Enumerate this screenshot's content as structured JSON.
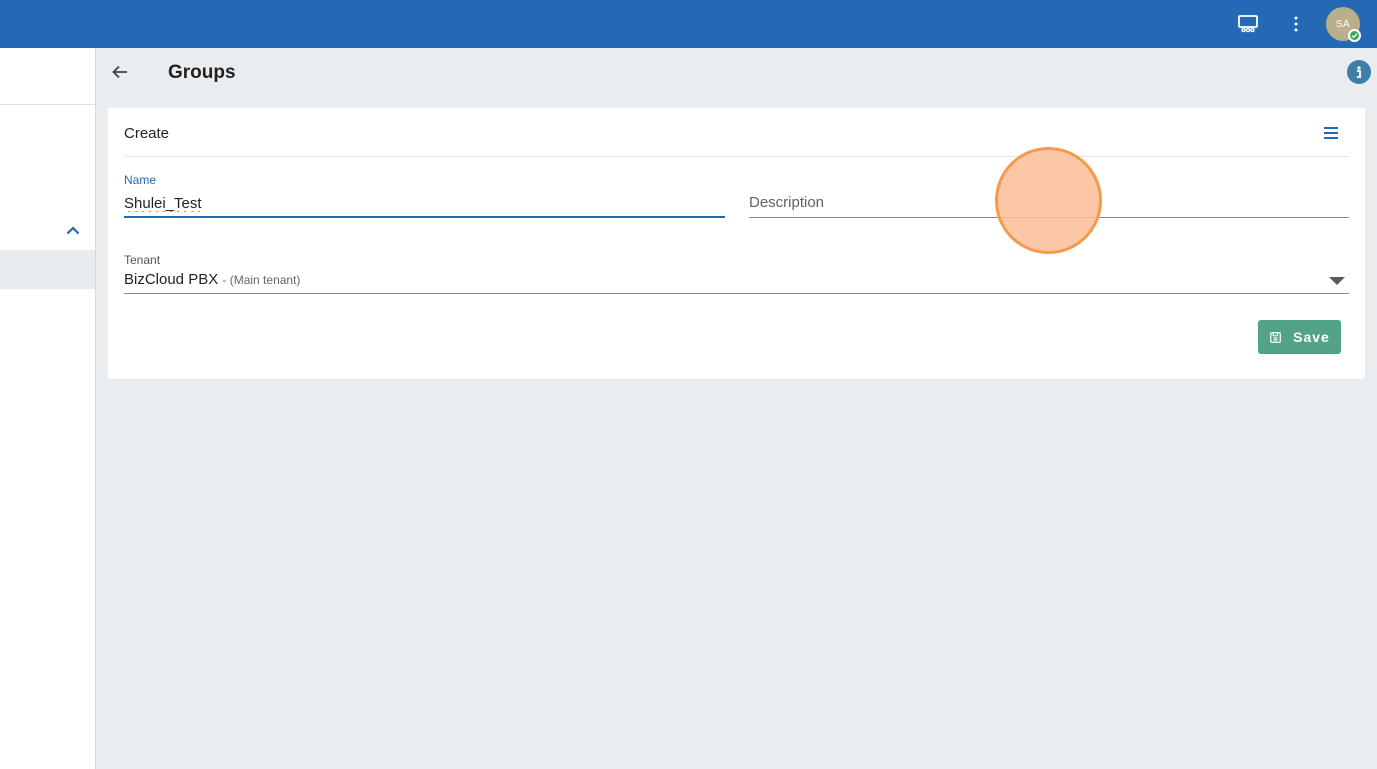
{
  "header": {
    "avatar_initials": "SA",
    "icons": [
      "screen-share-icon",
      "more-vert-icon"
    ]
  },
  "page": {
    "title": "Groups"
  },
  "card": {
    "title": "Create"
  },
  "form": {
    "name_label": "Name",
    "name_value": "Shulei_Test",
    "description_placeholder": "Description",
    "tenant_label": "Tenant",
    "tenant_value": "BizCloud PBX",
    "tenant_sub": "- (Main tenant)"
  },
  "actions": {
    "save_label": "Save"
  },
  "colors": {
    "header_bg": "#2469b3",
    "accent": "#2469b3",
    "save_bg": "#52a38a",
    "click_marker": "#f59a4c"
  }
}
